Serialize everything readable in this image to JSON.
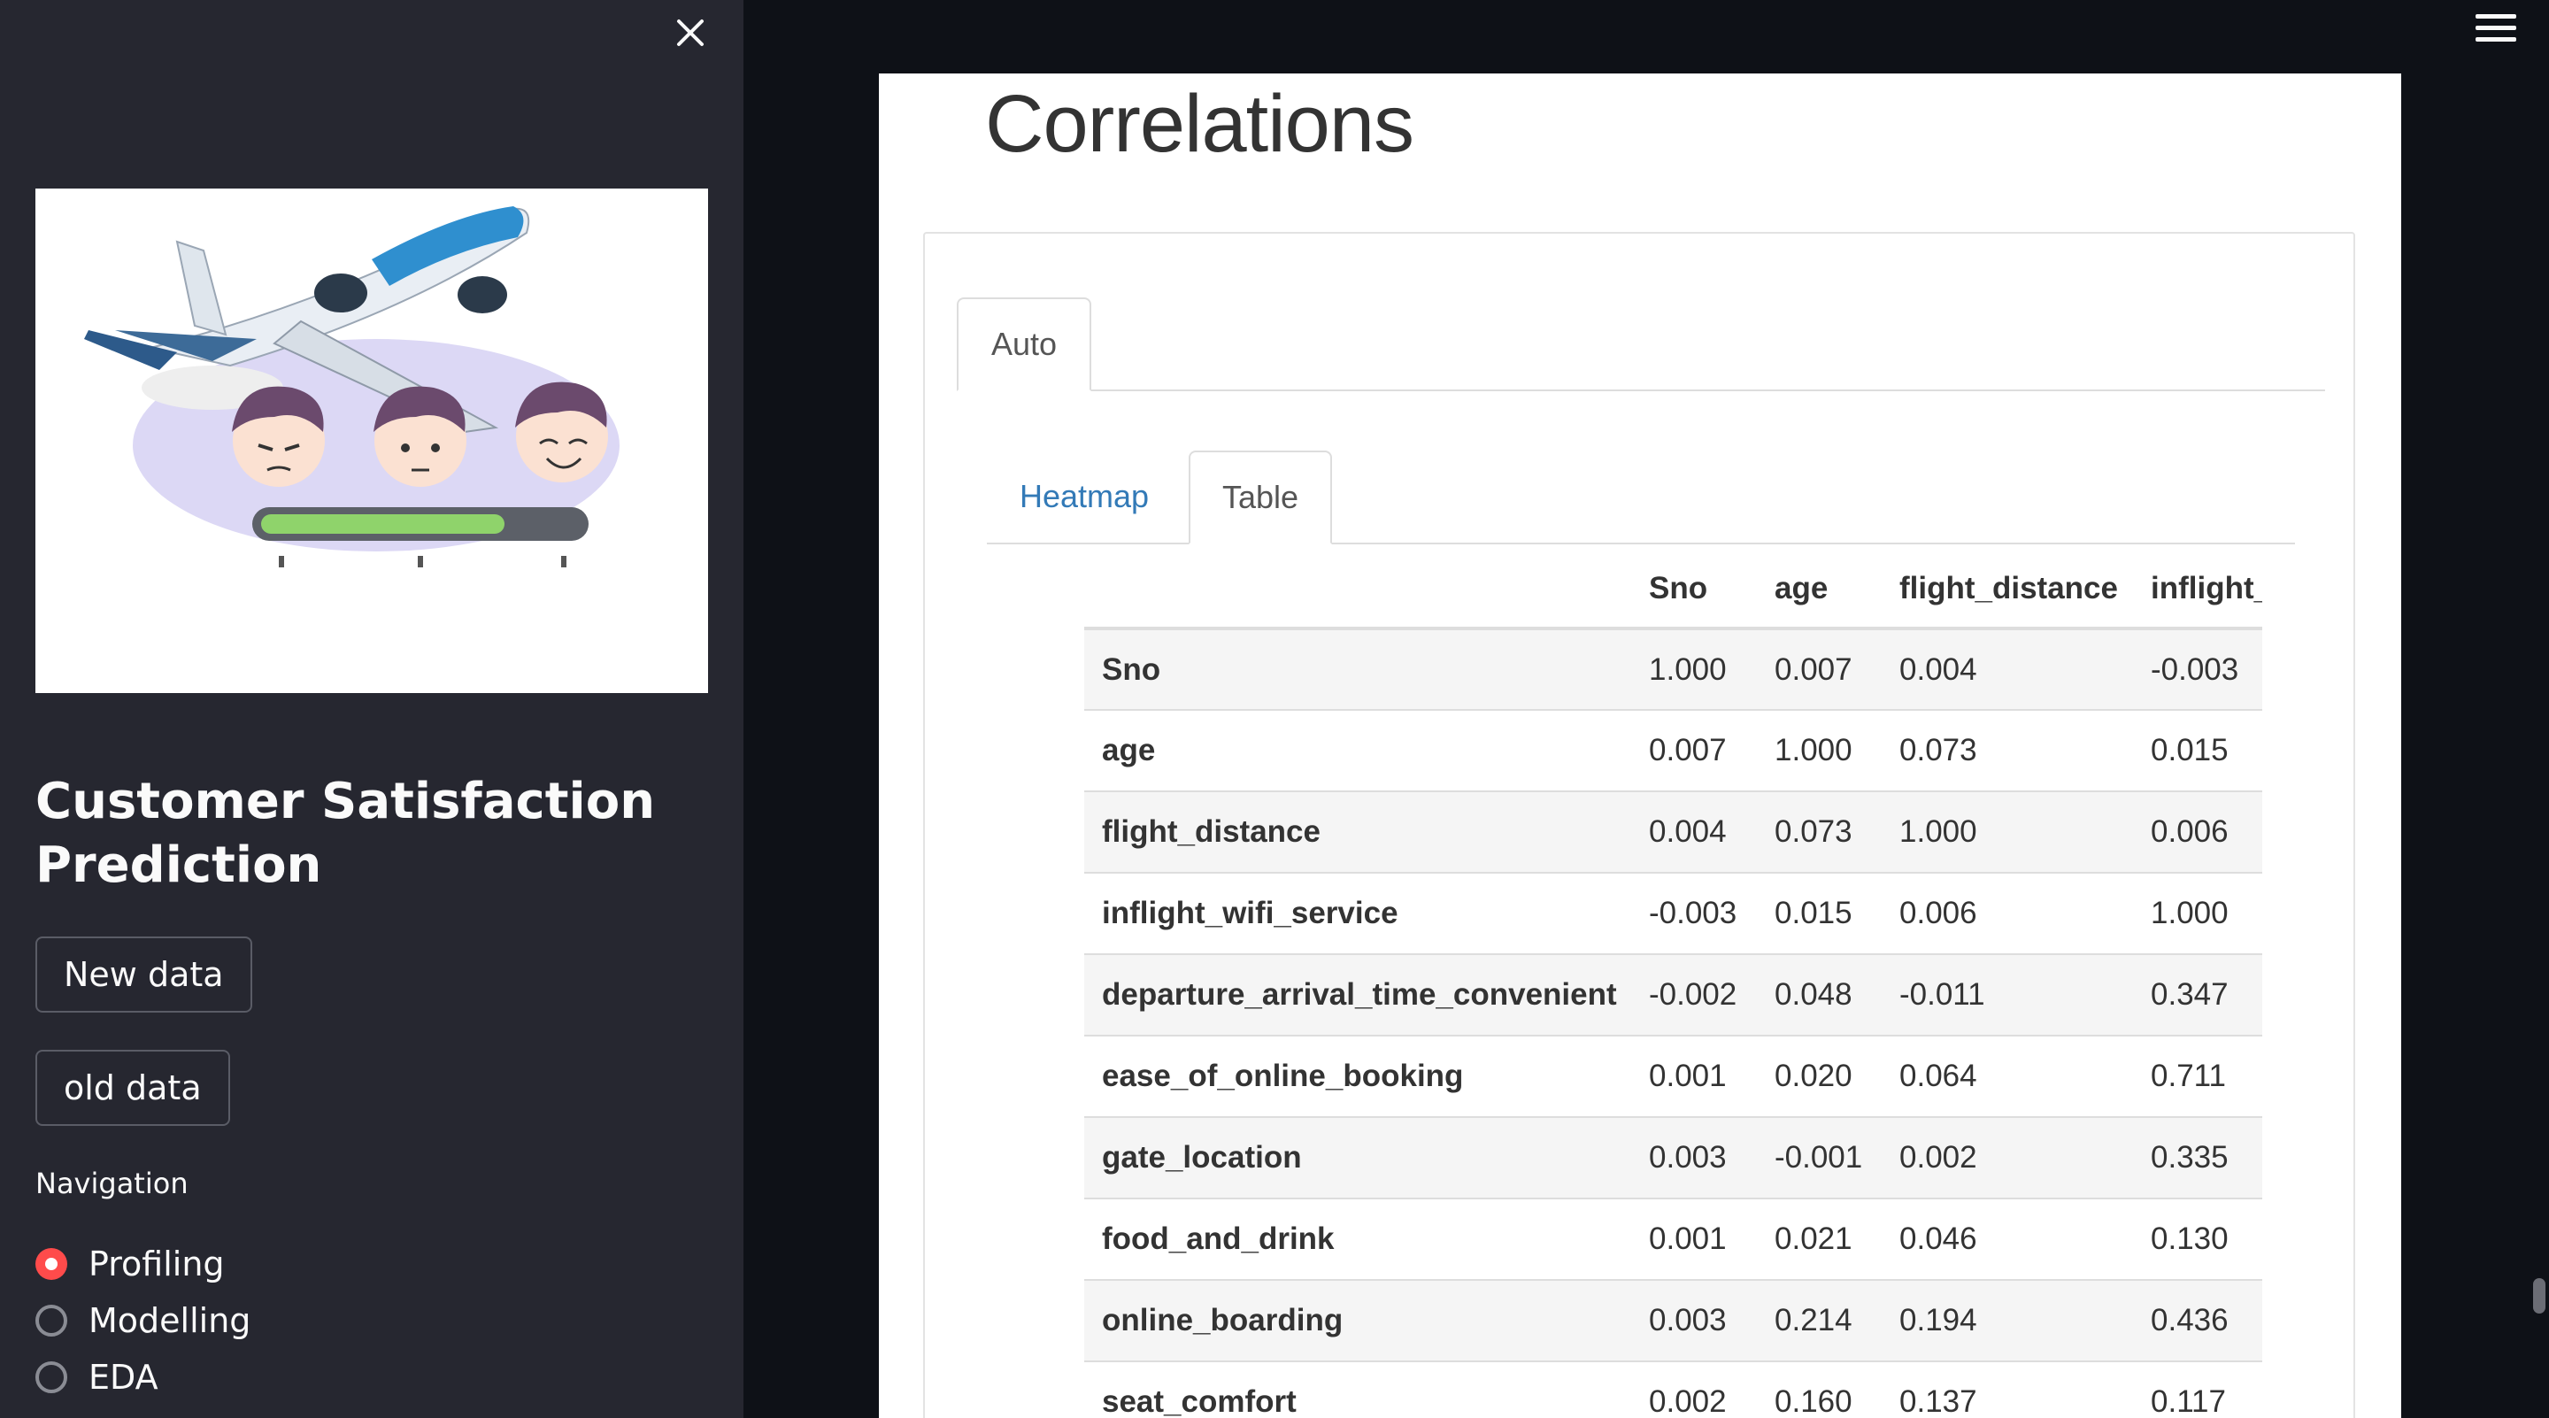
{
  "sidebar": {
    "app_title": "Customer Satisfaction Prediction",
    "buttons": {
      "new_data": "New data",
      "old_data": "old data"
    },
    "navigation": {
      "label": "Navigation",
      "options": [
        "Profiling",
        "Modelling",
        "EDA"
      ],
      "selected": "Profiling"
    },
    "image_icon": "airplane-customer-satisfaction-illustration"
  },
  "main": {
    "section_title": "Correlations",
    "outer_tabs": [
      "Auto"
    ],
    "inner_tabs": [
      "Heatmap",
      "Table"
    ],
    "active_inner_tab": "Table",
    "table": {
      "columns": [
        "",
        "Sno",
        "age",
        "flight_distance",
        "inflight_"
      ],
      "rows": [
        [
          "Sno",
          "1.000",
          "0.007",
          "0.004",
          "-0.003"
        ],
        [
          "age",
          "0.007",
          "1.000",
          "0.073",
          "0.015"
        ],
        [
          "flight_distance",
          "0.004",
          "0.073",
          "1.000",
          "0.006"
        ],
        [
          "inflight_wifi_service",
          "-0.003",
          "0.015",
          "0.006",
          "1.000"
        ],
        [
          "departure_arrival_time_convenient",
          "-0.002",
          "0.048",
          "-0.011",
          "0.347"
        ],
        [
          "ease_of_online_booking",
          "0.001",
          "0.020",
          "0.064",
          "0.711"
        ],
        [
          "gate_location",
          "0.003",
          "-0.001",
          "0.002",
          "0.335"
        ],
        [
          "food_and_drink",
          "0.001",
          "0.021",
          "0.046",
          "0.130"
        ],
        [
          "online_boarding",
          "0.003",
          "0.214",
          "0.194",
          "0.436"
        ],
        [
          "seat_comfort",
          "0.002",
          "0.160",
          "0.137",
          "0.117"
        ]
      ]
    }
  },
  "colors": {
    "sidebar_bg": "#262730",
    "main_bg": "#0e1117",
    "radio_selected": "#ff4b4b",
    "tab_link": "#337ab7"
  },
  "icons": {
    "close": "close-icon",
    "menu": "hamburger-menu-icon"
  }
}
